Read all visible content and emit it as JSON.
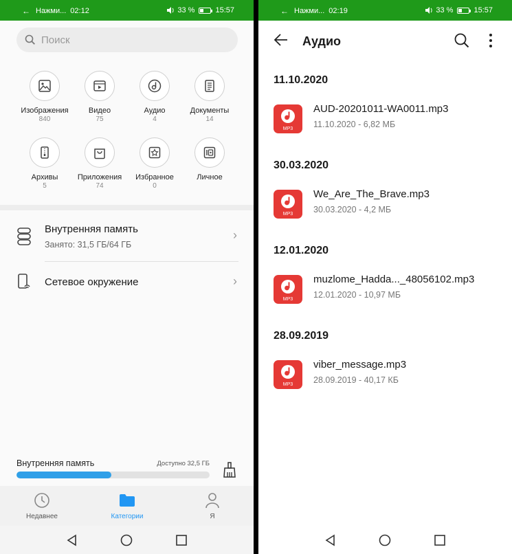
{
  "left": {
    "status": {
      "notif": "Нажми...",
      "time_left": "02:12",
      "battery": "33 %",
      "battery_level": 0.33,
      "time_right": "15:57"
    },
    "search": {
      "placeholder": "Поиск"
    },
    "categories": [
      {
        "label": "Изображения",
        "count": "840",
        "icon": "image-icon"
      },
      {
        "label": "Видео",
        "count": "75",
        "icon": "video-icon"
      },
      {
        "label": "Аудио",
        "count": "4",
        "icon": "audio-icon"
      },
      {
        "label": "Документы",
        "count": "14",
        "icon": "document-icon"
      },
      {
        "label": "Архивы",
        "count": "5",
        "icon": "archive-icon"
      },
      {
        "label": "Приложения",
        "count": "74",
        "icon": "apps-icon"
      },
      {
        "label": "Избранное",
        "count": "0",
        "icon": "favorites-icon"
      },
      {
        "label": "Личное",
        "count": "",
        "icon": "safe-icon"
      }
    ],
    "internal": {
      "title": "Внутренняя память",
      "sub": "Занято: 31,5 ГБ/64 ГБ"
    },
    "network": {
      "title": "Сетевое окружение"
    },
    "storage_bar": {
      "label": "Внутренняя память",
      "free": "Доступно 32,5 ГБ",
      "used_fraction": 0.49
    },
    "tabs": [
      {
        "label": "Недавнее",
        "icon": "clock-icon",
        "active": false
      },
      {
        "label": "Категории",
        "icon": "folder-icon",
        "active": true
      },
      {
        "label": "Я",
        "icon": "person-icon",
        "active": false
      }
    ]
  },
  "right": {
    "status": {
      "notif": "Нажми...",
      "time_left": "02:19",
      "battery": "33 %",
      "battery_level": 0.33,
      "time_right": "15:57"
    },
    "title": "Аудио",
    "groups": [
      {
        "date": "11.10.2020",
        "file": "AUD-20201011-WA0011.mp3",
        "meta": "11.10.2020 - 6,82 МБ"
      },
      {
        "date": "30.03.2020",
        "file": "We_Are_The_Brave.mp3",
        "meta": "30.03.2020 - 4,2 МБ"
      },
      {
        "date": "12.01.2020",
        "file": "muzlome_Hadda..._48056102.mp3",
        "meta": "12.01.2020 - 10,97 МБ"
      },
      {
        "date": "28.09.2019",
        "file": "viber_message.mp3",
        "meta": "28.09.2019 - 40,17 КБ"
      }
    ],
    "file_badge": "MP3"
  },
  "colors": {
    "statusbar": "#1f9a1a",
    "accent": "#2196f3",
    "audio_red": "#e53935"
  }
}
